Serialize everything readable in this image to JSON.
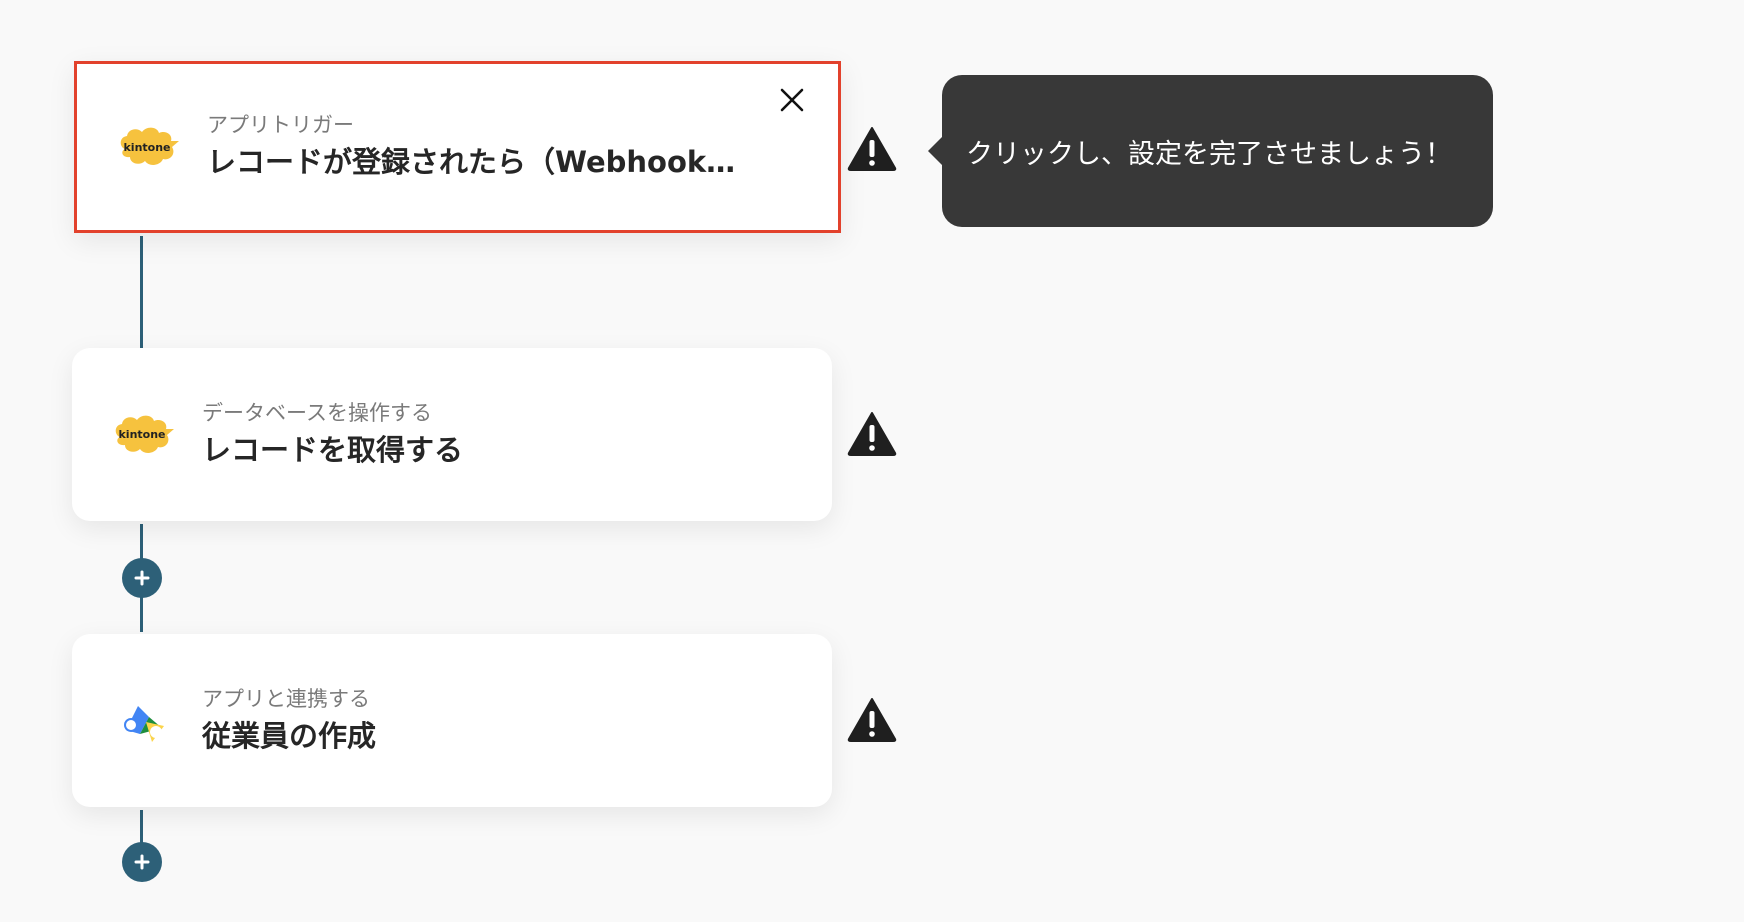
{
  "tooltip": {
    "text": "クリックし、設定を完了させましょう！"
  },
  "steps": [
    {
      "subtitle": "アプリトリガー",
      "title": "レコードが登録されたら（Webhook…",
      "icon": "kintone-logo",
      "logo_text": "kintone",
      "selected": true,
      "status": "warning"
    },
    {
      "subtitle": "データベースを操作する",
      "title": "レコードを取得する",
      "icon": "kintone-logo",
      "logo_text": "kintone",
      "selected": false,
      "status": "warning"
    },
    {
      "subtitle": "アプリと連携する",
      "title": "従業員の作成",
      "icon": "google-workspace-admin-logo",
      "selected": false,
      "status": "warning"
    }
  ],
  "colors": {
    "selected_border": "#e2412c",
    "connector": "#2d6078",
    "tooltip_bg": "#383838",
    "kintone_yellow": "#f6c23e"
  },
  "icons": {
    "close": "close-icon",
    "warning": "warning-icon",
    "add": "plus-icon"
  }
}
